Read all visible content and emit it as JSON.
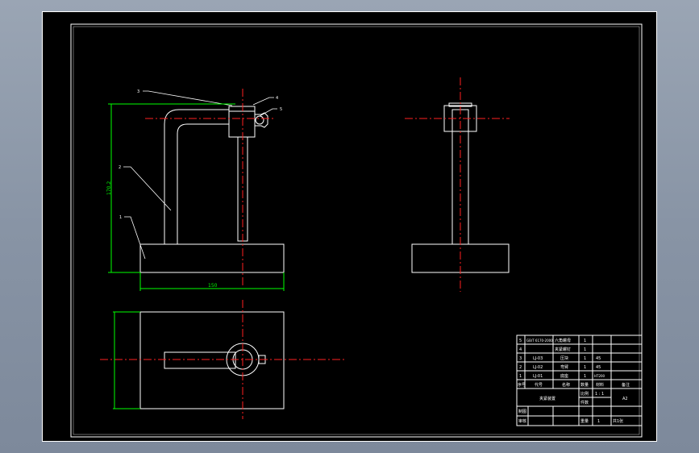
{
  "drawing": {
    "colors": {
      "background": "#000000",
      "geometry": "#ffffff",
      "centerline": "#ff2020",
      "dimension": "#00ff00",
      "outer": "#8f9aab"
    },
    "dimensions": {
      "height": "170.2",
      "width": "150"
    },
    "balloons": [
      "1",
      "2",
      "3",
      "4",
      "5"
    ],
    "title_block": {
      "parts": [
        {
          "no": "5",
          "code": "GB/T 6170-2000",
          "name": "六角螺母",
          "qty": "1",
          "material": "",
          "note": ""
        },
        {
          "no": "4",
          "code": "",
          "name": "夹紧螺钉",
          "qty": "1",
          "material": "",
          "note": ""
        },
        {
          "no": "3",
          "code": "LJ-03",
          "name": "压块",
          "qty": "1",
          "material": "45",
          "note": ""
        },
        {
          "no": "2",
          "code": "LJ-02",
          "name": "弯臂",
          "qty": "1",
          "material": "45",
          "note": ""
        },
        {
          "no": "1",
          "code": "LJ-01",
          "name": "底座",
          "qty": "1",
          "material": "HT200",
          "note": ""
        }
      ],
      "headers": {
        "no": "序号",
        "code": "代号",
        "name": "名称",
        "qty": "数量",
        "material": "材料",
        "note": "备注"
      },
      "title": "夹紧装置",
      "scale_label": "比例",
      "scale_value": "1 : 1",
      "qty_label": "件数",
      "sheet_no": "A2",
      "draw_label": "制图",
      "check_label": "审核",
      "weight_label": "重量",
      "weight_value": "1",
      "sheet_label": "共1张"
    }
  }
}
